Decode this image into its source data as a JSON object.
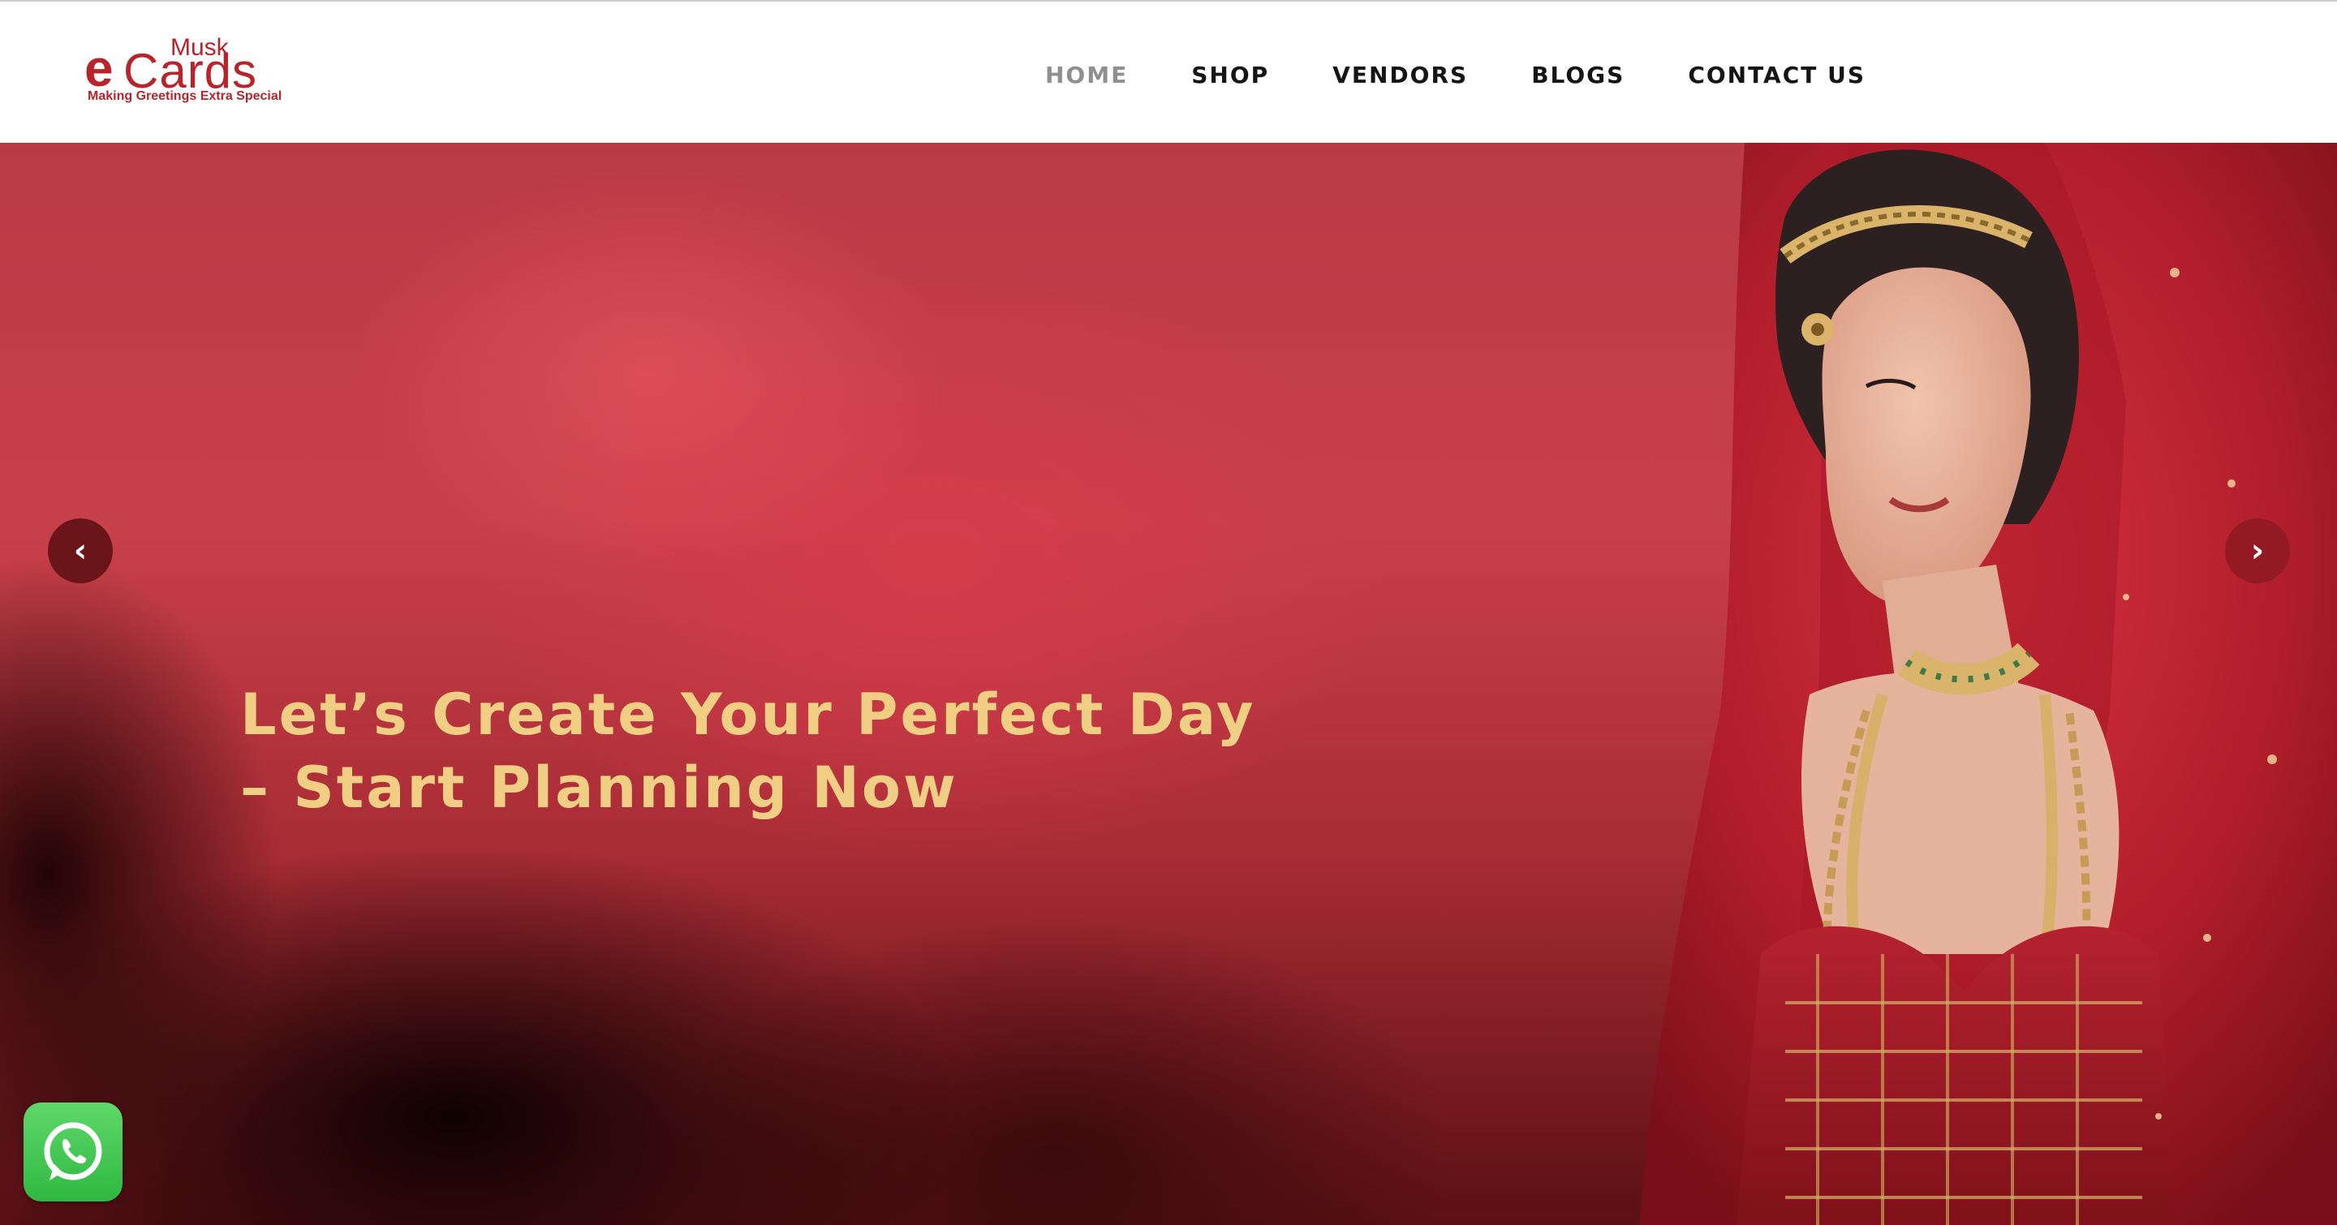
{
  "brand": {
    "logo_e": "e",
    "logo_musk": "Musk",
    "logo_cards": "Cards",
    "tagline": "Making Greetings Extra Special"
  },
  "nav": {
    "items": [
      {
        "label": "HOME",
        "active": true
      },
      {
        "label": "SHOP",
        "active": false
      },
      {
        "label": "VENDORS",
        "active": false
      },
      {
        "label": "BLOGS",
        "active": false
      },
      {
        "label": "CONTACT US",
        "active": false
      }
    ]
  },
  "hero": {
    "title_line1": "Let’s Create Your Perfect Day",
    "title_line2": "– Start Planning Now",
    "prev_icon": "chevron-left-icon",
    "next_icon": "chevron-right-icon",
    "prev_glyph": "‹",
    "next_glyph": "›"
  },
  "whatsapp": {
    "icon": "whatsapp-icon"
  },
  "colors": {
    "brand_red": "#b7242b",
    "nav_text": "#151515",
    "nav_active": "#8f8f8f",
    "hero_title": "#f0cf85",
    "whatsapp_green": "#2fb842"
  }
}
